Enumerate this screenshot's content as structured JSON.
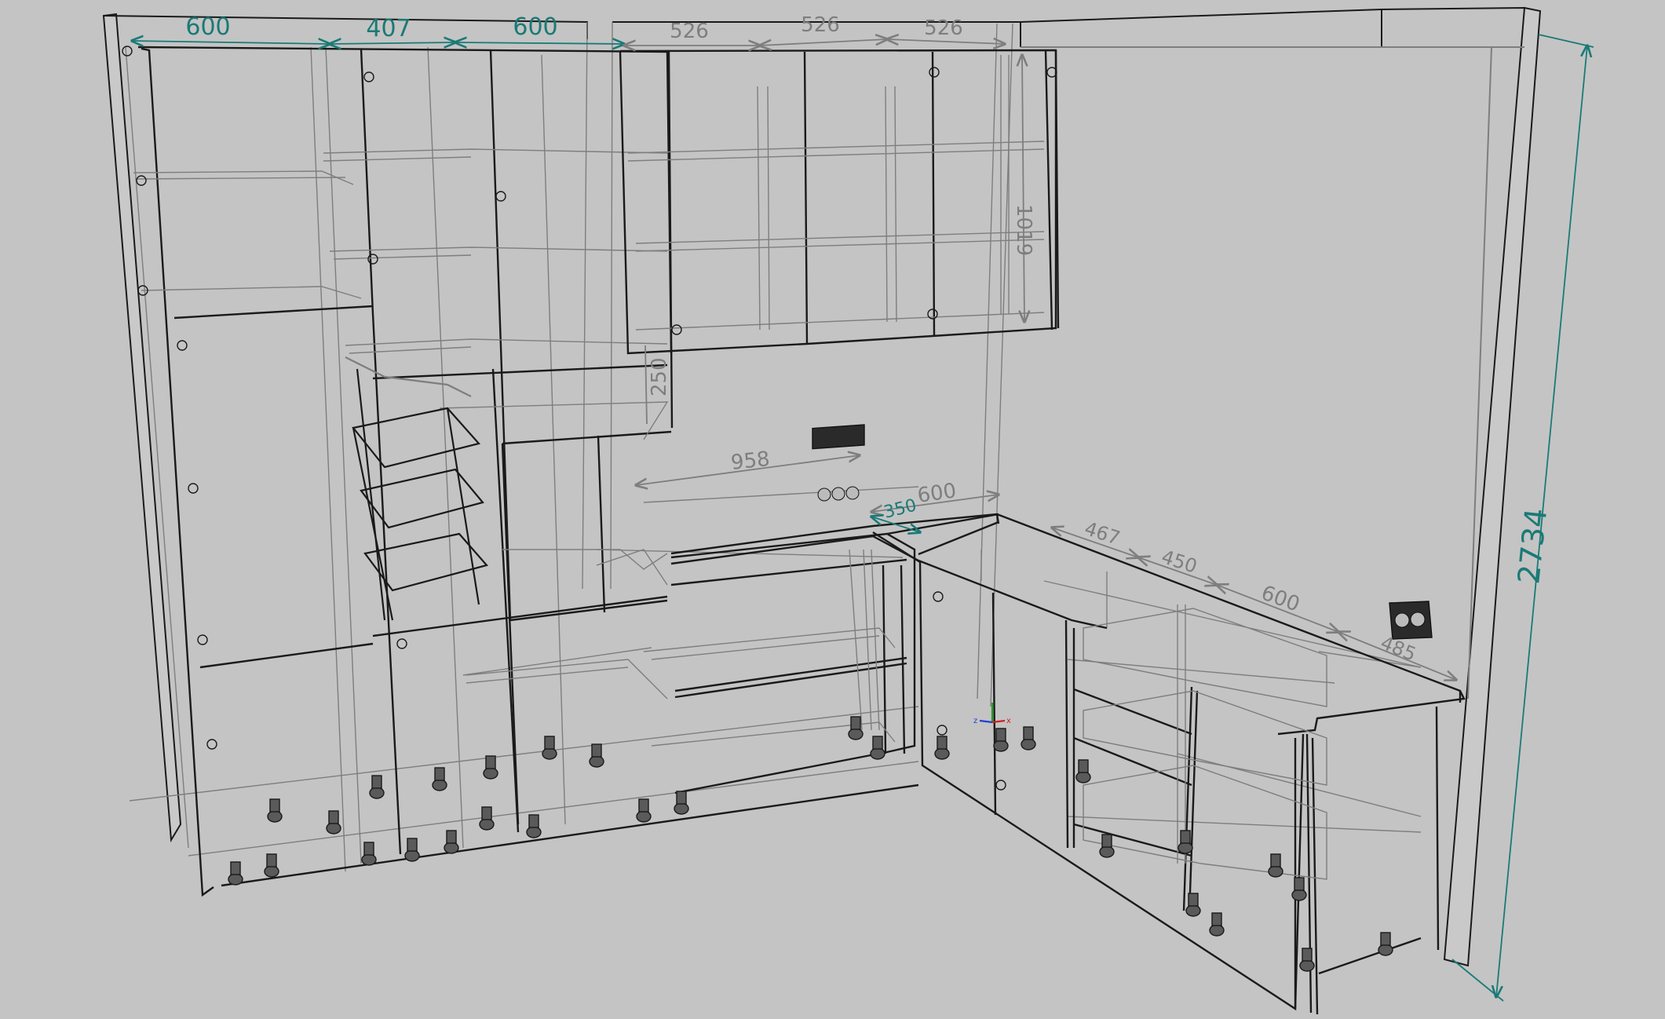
{
  "dimensions": {
    "top_left": [
      "600",
      "407",
      "600"
    ],
    "top_right": [
      "526",
      "526",
      "526"
    ],
    "vertical_1019": "1019",
    "vertical_250": "250",
    "countertop_958": "958",
    "depth_350": "350",
    "return_600": "600",
    "right_run": [
      "467",
      "450",
      "600",
      "485"
    ],
    "height_total": "2734"
  },
  "colors": {
    "background": "#c4c4c4",
    "line_dark": "#1a1a1a",
    "line_light": "#7e7e7e",
    "dim_accent": "#1a7a76",
    "axis_x": "#d02020",
    "axis_y": "#1ea01e",
    "axis_z": "#2040d0"
  },
  "icons": [
    "socket-triple-icon",
    "socket-double-icon",
    "axis-gizmo-icon"
  ]
}
